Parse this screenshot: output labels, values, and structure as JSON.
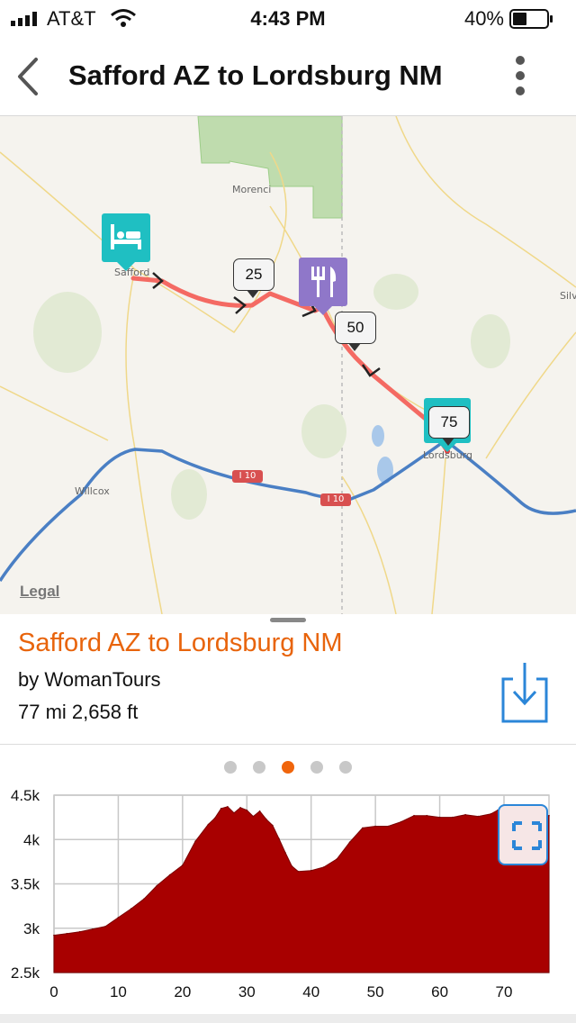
{
  "status_bar": {
    "carrier": "AT&T",
    "time": "4:43 PM",
    "battery": "40%"
  },
  "nav": {
    "back_icon": "chevron-left-icon",
    "title": "Safford AZ to Lordsburg NM",
    "menu_icon": "more-vertical-icon"
  },
  "map": {
    "labels": {
      "morenci": "Morenci",
      "safford": "Safford",
      "lordsburg": "Lordsburg",
      "willcox": "Willcox",
      "silver": "Silv"
    },
    "highway_shields": [
      "I 10",
      "I 10"
    ],
    "mile_markers": [
      "25",
      "50",
      "75"
    ],
    "legal": "Legal",
    "colors": {
      "route": "#f46a63",
      "interstate": "#4a7fc4",
      "lodging": "#1fbfc2",
      "food": "#8f77c9"
    }
  },
  "route": {
    "title": "Safford AZ to Lordsburg NM",
    "author": "by WomanTours",
    "distance": "77 mi",
    "elevation_gain": "2,658 ft",
    "download_icon": "download-icon"
  },
  "pager": {
    "count": 5,
    "active_index": 2,
    "active_color": "#f0650c"
  },
  "chart_data": {
    "type": "area",
    "x_ticks": [
      "0",
      "10",
      "20",
      "30",
      "40",
      "50",
      "60",
      "70"
    ],
    "y_ticks": [
      "4.5k",
      "4k",
      "3.5k",
      "3k",
      "2.5k"
    ],
    "xlim": [
      0,
      77
    ],
    "ylim": [
      2500,
      4500
    ],
    "color": "#a80000",
    "x": [
      0,
      2,
      4,
      6,
      8,
      10,
      12,
      14,
      16,
      18,
      20,
      22,
      24,
      25,
      26,
      27,
      28,
      29,
      30,
      31,
      32,
      33,
      34,
      35,
      36,
      37,
      38,
      40,
      42,
      44,
      46,
      48,
      50,
      52,
      54,
      56,
      58,
      60,
      62,
      64,
      66,
      68,
      69,
      70,
      72,
      74,
      77
    ],
    "y": [
      2920,
      2940,
      2960,
      2990,
      3020,
      3120,
      3220,
      3330,
      3480,
      3600,
      3710,
      3980,
      4170,
      4240,
      4350,
      4370,
      4300,
      4360,
      4330,
      4260,
      4320,
      4230,
      4160,
      4010,
      3850,
      3700,
      3640,
      3650,
      3690,
      3780,
      3970,
      4130,
      4150,
      4150,
      4200,
      4270,
      4270,
      4250,
      4250,
      4280,
      4260,
      4290,
      4330,
      4260,
      4290,
      4280,
      4270
    ]
  },
  "chart": {
    "expand_icon": "fullscreen-icon"
  }
}
